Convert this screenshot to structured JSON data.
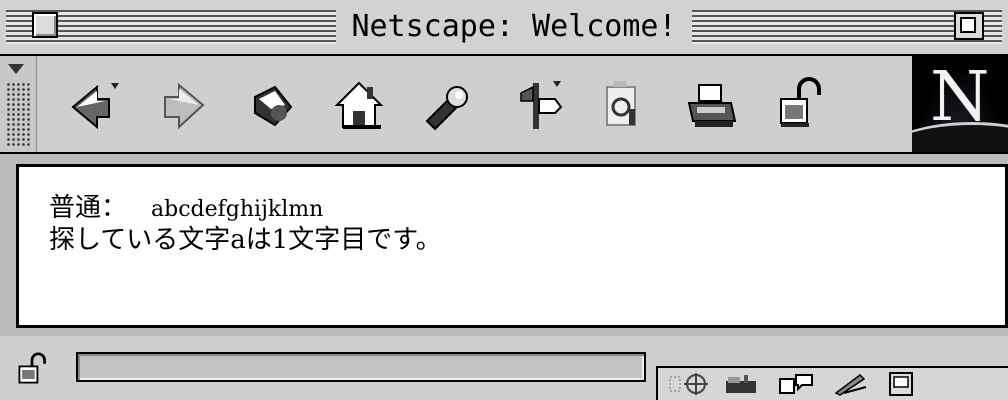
{
  "window": {
    "title": "Netscape: Welcome!"
  },
  "toolbar": {
    "buttons": [
      {
        "name": "back",
        "icon": "back-arrow-icon"
      },
      {
        "name": "forward",
        "icon": "forward-arrow-icon"
      },
      {
        "name": "reload",
        "icon": "reload-icon"
      },
      {
        "name": "home",
        "icon": "home-icon"
      },
      {
        "name": "search",
        "icon": "flashlight-icon"
      },
      {
        "name": "guide",
        "icon": "signpost-icon"
      },
      {
        "name": "images",
        "icon": "images-icon"
      },
      {
        "name": "print",
        "icon": "printer-icon"
      },
      {
        "name": "security",
        "icon": "padlock-icon"
      }
    ],
    "logo_letter": "N"
  },
  "content": {
    "line1_label": "普通：",
    "line1_sample": "abcdefghijklmn",
    "line2": "探している文字aは1文字目です。"
  },
  "statusbar": {
    "status_text": "",
    "component_icons": [
      "navigator-icon",
      "mailbox-icon",
      "discussion-icon",
      "composer-icon",
      "toggle-icon"
    ]
  }
}
